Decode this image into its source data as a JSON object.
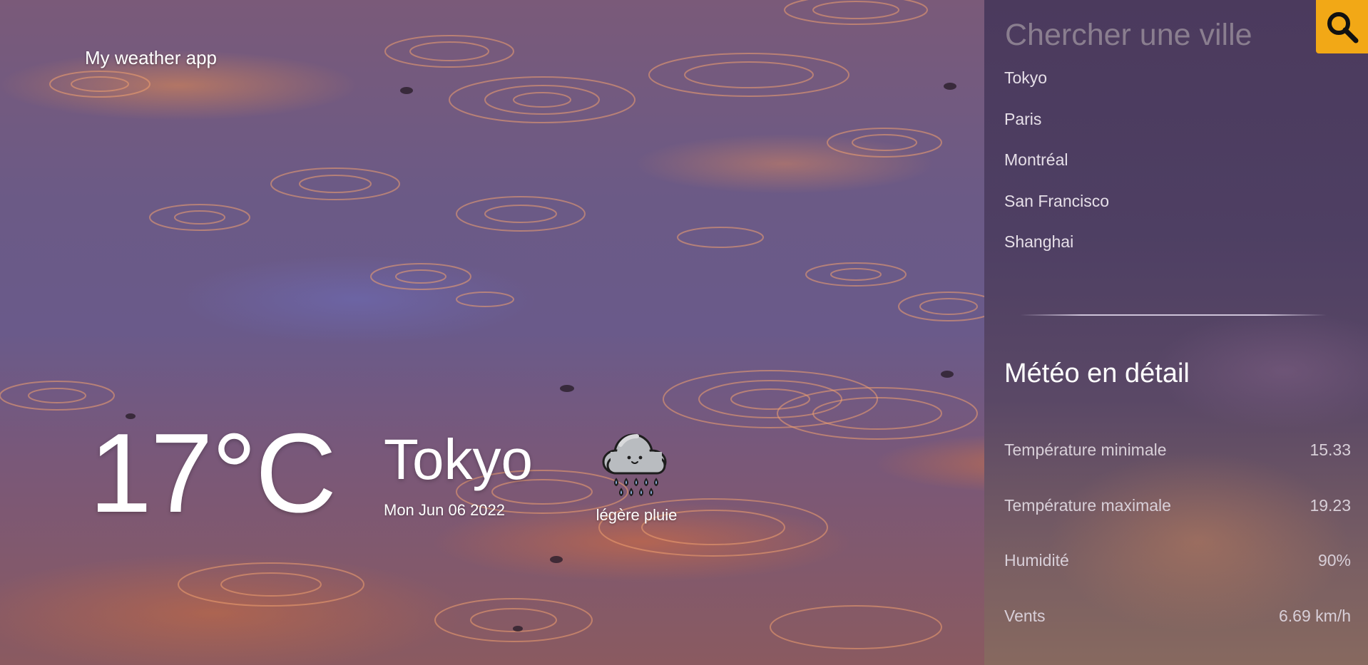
{
  "app": {
    "title": "My weather app"
  },
  "current": {
    "temperature": "17°C",
    "city": "Tokyo",
    "date": "Mon Jun 06 2022",
    "condition": "légère pluie",
    "condition_icon": "rain-cloud-icon"
  },
  "sidebar": {
    "search": {
      "placeholder": "Chercher une ville",
      "button_icon": "search-icon"
    },
    "cities": [
      "Tokyo",
      "Paris",
      "Montréal",
      "San Francisco",
      "Shanghai"
    ],
    "details_title": "Météo en détail",
    "details": [
      {
        "label": "Température minimale",
        "value": "15.33"
      },
      {
        "label": "Température maximale",
        "value": "19.23"
      },
      {
        "label": "Humidité",
        "value": "90%"
      },
      {
        "label": "Vents",
        "value": "6.69 km/h"
      }
    ]
  },
  "colors": {
    "accent": "#f2a816",
    "text": "#ffffff",
    "panel": "#4e3f63"
  }
}
